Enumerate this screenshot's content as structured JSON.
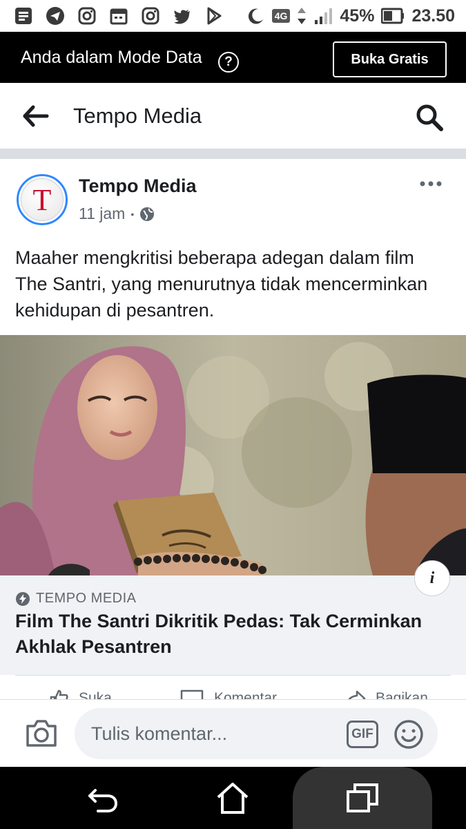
{
  "status_bar": {
    "network": "4G",
    "battery": "45%",
    "time": "23.50",
    "icons": [
      "notes-icon",
      "telegram-icon",
      "instagram-icon",
      "calendar-icon",
      "instagram-icon",
      "twitter-icon",
      "play-store-icon",
      "moon-icon",
      "signal-icon",
      "battery-icon"
    ]
  },
  "data_mode": {
    "message": "Anda dalam Mode Data",
    "help": "?",
    "button": "Buka Gratis"
  },
  "header": {
    "title": "Tempo Media"
  },
  "post": {
    "avatar_letter": "T",
    "page_name": "Tempo Media",
    "time": "11 jam",
    "separator": "•",
    "text": "Maaher mengkritisi beberapa adegan dalam film The Santri, yang menurutnya tidak mencerminkan kehidupan di pesantren.",
    "info": "i",
    "link": {
      "source": "TEMPO MEDIA",
      "title": "Film The Santri Dikritik Pedas: Tak Cerminkan Akhlak Pesantren"
    },
    "actions": [
      "Suka",
      "Komentar",
      "Bagikan"
    ]
  },
  "comment_bar": {
    "placeholder": "Tulis komentar...",
    "gif": "GIF"
  },
  "colors": {
    "banner_bg": "#000000",
    "accent_blue": "#2d88ff",
    "link_bg": "#f0f2f5",
    "logo_red": "#c8102e"
  }
}
